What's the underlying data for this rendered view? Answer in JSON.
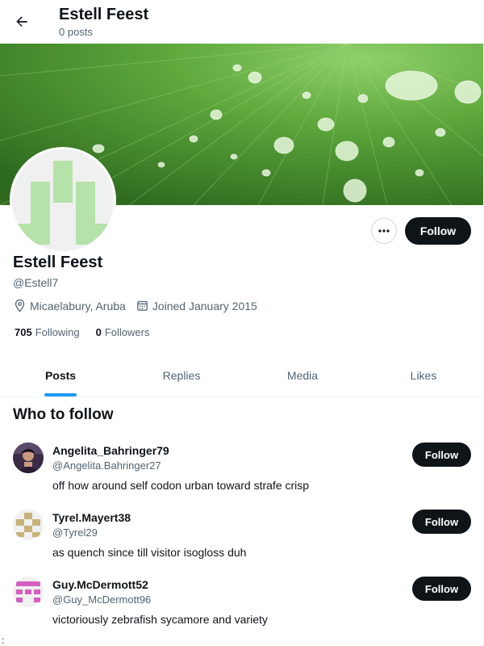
{
  "header": {
    "name": "Estell Feest",
    "posts_count": "0 posts"
  },
  "profile": {
    "name": "Estell Feest",
    "handle": "@Estell7",
    "location": "Micaelabury, Aruba",
    "joined": "Joined January 2015",
    "following_count": "705",
    "following_label": "Following",
    "followers_count": "0",
    "followers_label": "Followers",
    "follow_label": "Follow"
  },
  "tabs": [
    {
      "label": "Posts",
      "active": true
    },
    {
      "label": "Replies",
      "active": false
    },
    {
      "label": "Media",
      "active": false
    },
    {
      "label": "Likes",
      "active": false
    }
  ],
  "who_to_follow": {
    "title": "Who to follow",
    "suggestions": [
      {
        "name": "Angelita_Bahringer79",
        "handle": "@Angelita.Bahringer27",
        "bio": "off how around self codon urban toward strafe crisp",
        "follow_label": "Follow"
      },
      {
        "name": "Tyrel.Mayert38",
        "handle": "@Tyrel29",
        "bio": "as quench since till visitor isogloss duh",
        "follow_label": "Follow"
      },
      {
        "name": "Guy.McDermott52",
        "handle": "@Guy_McDermott96",
        "bio": "victoriously zebrafish sycamore and variety",
        "follow_label": "Follow"
      }
    ]
  },
  "stray_text": ":",
  "colors": {
    "accent": "#1d9bf0",
    "button_dark": "#0f1419",
    "muted_text": "#536471",
    "avatar_green": "#b5e2a8",
    "tyrel_gold": "#c7b27a",
    "guy_pink": "#d45fc0"
  },
  "icons": [
    "back-arrow-icon",
    "more-dots-icon",
    "location-pin-icon",
    "calendar-icon"
  ]
}
